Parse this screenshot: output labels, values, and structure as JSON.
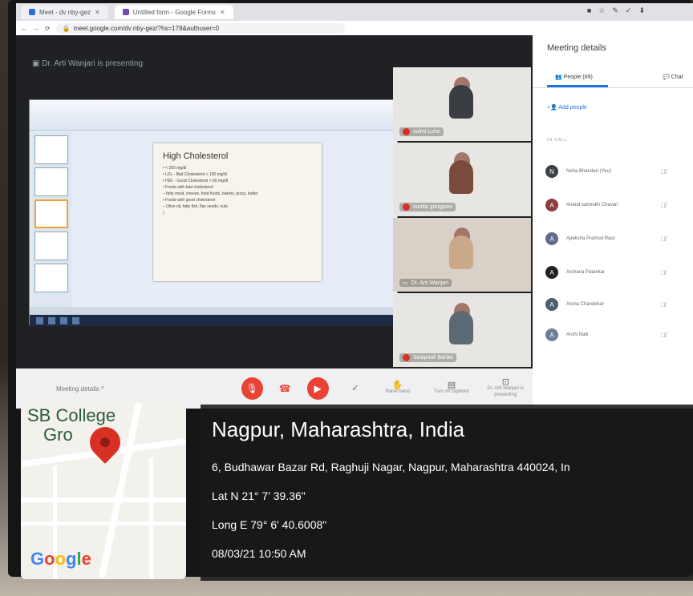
{
  "browser": {
    "tabs": [
      {
        "label": "Meet - dv nby-gez"
      },
      {
        "label": "Untitled form - Google Forms"
      }
    ],
    "url": "meet.google.com/dv nby-gez/?hs=178&authuser=0"
  },
  "meet": {
    "presenting_label": "Dr. Arti Wanjari is presenting",
    "slide": {
      "title": "High Cholesterol",
      "bullets": [
        "• < 200 mg/dl",
        "• LDL - Bad Cholesterol < 100 mg/dl",
        "• HDL - Good Cholesterol > 50 mg/dl",
        "• Foods with bad cholesterol",
        "  – fatty meat, cheese, fried foods, bakery, pizza, butter",
        "• Foods with good cholesterol",
        "  – Olive oil, fatty fish, flax seeds, nuts",
        "  )"
      ]
    },
    "tiles": [
      {
        "name": "sulmi Lohe",
        "shirt": "#3b3d44"
      },
      {
        "name": "sunita gongpaw",
        "shirt": "#7b4a3a"
      },
      {
        "name": "Dr. Arti Wanjari",
        "shirt": "#c9a98a"
      },
      {
        "name": "Swapnali Barlas",
        "shirt": "#5b6a72"
      }
    ],
    "callbar": {
      "meeting_details": "Meeting details ^",
      "tools": [
        {
          "label": "Raise hand",
          "icon": "✋"
        },
        {
          "label": "Turn on captions",
          "icon": "▤"
        },
        {
          "label": "Dr. Arti Wanjari is presenting",
          "icon": "⊡"
        }
      ]
    }
  },
  "panel": {
    "title": "Meeting details",
    "people_tab": "People (89)",
    "chat_tab": "Chat",
    "add_people": "Add people",
    "in_call": "IN CALL",
    "people": [
      {
        "name": "Neha Bhandari (You)",
        "initial": "N",
        "color": "#3c4043"
      },
      {
        "name": "Anand sarmukh Chavan",
        "initial": "A",
        "color": "#8e3b3b"
      },
      {
        "name": "Apeksha Pramod Raut",
        "initial": "A",
        "color": "#5f6b8a"
      },
      {
        "name": "Archana Patankar",
        "initial": "A",
        "color": "#202124"
      },
      {
        "name": "Aruna Chandekar",
        "initial": "A",
        "color": "#4b5f70"
      },
      {
        "name": "Arohi Naik",
        "initial": "A",
        "color": "#6e7f9a"
      }
    ]
  },
  "geotag": {
    "map_label_1": "SB College",
    "map_label_2": "Gro",
    "google": [
      "G",
      "o",
      "o",
      "g",
      "l",
      "e"
    ],
    "google_colors": [
      "#4285f4",
      "#ea4335",
      "#fbbc05",
      "#4285f4",
      "#34a853",
      "#ea4335"
    ],
    "city": "Nagpur, Maharashtra, India",
    "address": "6, Budhawar Bazar Rd, Raghuji Nagar, Nagpur, Maharashtra 440024, In",
    "lat": "Lat N 21° 7' 39.36\"",
    "long": "Long E 79° 6' 40.6008\"",
    "datetime": "08/03/21 10:50 AM"
  }
}
